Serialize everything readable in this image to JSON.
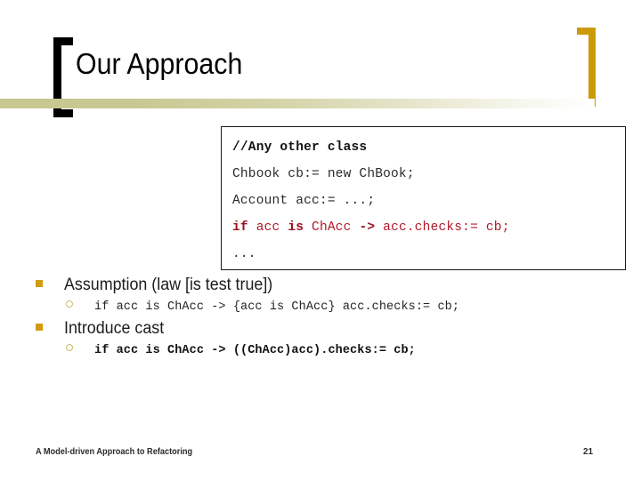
{
  "slide": {
    "title": "Our Approach",
    "accent_color": "#cc9a08",
    "rule_color": "#c8c790",
    "bracket_left_color": "#000000",
    "bracket_right_color": "#cc9a08"
  },
  "code_box": {
    "lines": [
      {
        "id": "comment",
        "text": "//Any other class",
        "style": "bold"
      },
      {
        "id": "chbook",
        "text": "Chbook cb:= new ChBook;",
        "style": "plain"
      },
      {
        "id": "account",
        "text": "Account acc:= ...;",
        "style": "plain"
      },
      {
        "id": "ifline",
        "text": "if acc is ChAcc -> acc.checks:= cb;",
        "style": "red"
      },
      {
        "id": "ellipsis",
        "text": "...",
        "style": "plain"
      }
    ],
    "if_line_parts": {
      "kw_if": "if",
      "mid1": " acc ",
      "kw_is": "is",
      "mid2": " ChAcc ",
      "kw_arrow": "->",
      "tail": " acc.checks:= cb;"
    },
    "border_color": "#1a1a1a",
    "highlight_color": "#b01828"
  },
  "bullets": [
    {
      "level": 1,
      "marker": "square-bullet",
      "text": "Assumption (law [is test true])"
    },
    {
      "level": 2,
      "marker": "circle-bullet",
      "text": "if acc is ChAcc -> {acc is ChAcc} acc.checks:= cb;",
      "bold": false
    },
    {
      "level": 1,
      "marker": "square-bullet",
      "text": "Introduce cast"
    },
    {
      "level": 2,
      "marker": "circle-bullet",
      "text": "if acc is ChAcc -> ((ChAcc)acc).checks:= cb;",
      "bold": true
    }
  ],
  "footer": {
    "left": "A Model-driven Approach to Refactoring",
    "page_number": "21"
  }
}
